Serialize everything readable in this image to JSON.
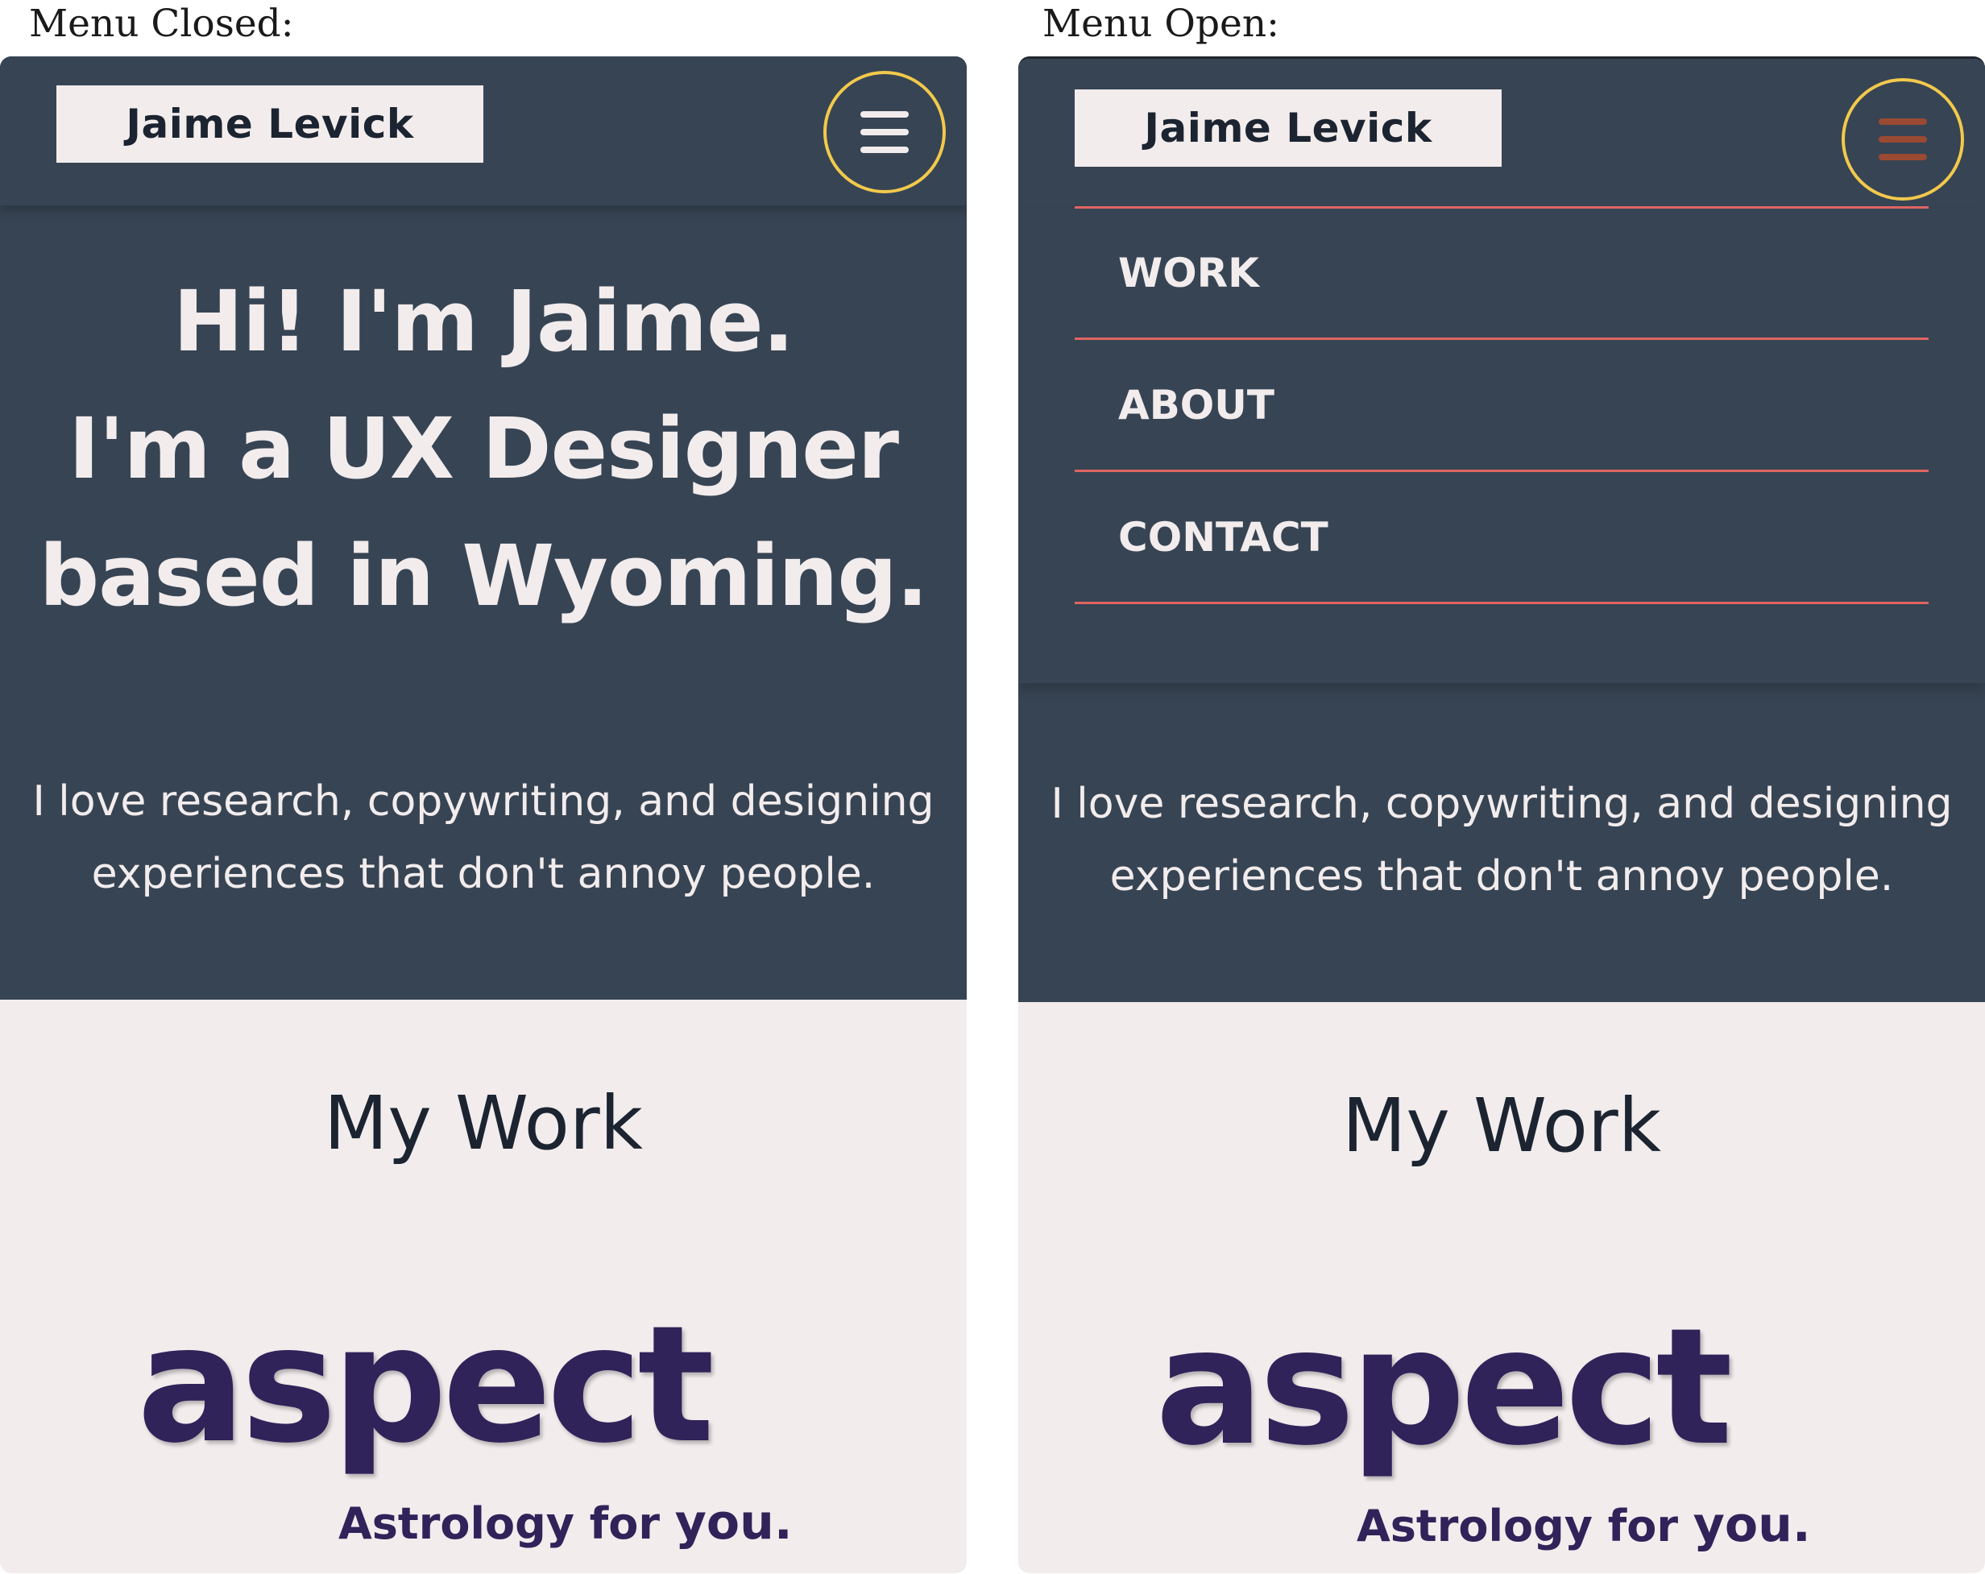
{
  "captions": {
    "closed": "Menu Closed:",
    "open": "Menu Open:"
  },
  "site": {
    "logo_text": "Jaime Levick",
    "headline": [
      "Hi! I'm Jaime.",
      "I'm a UX Designer",
      "based in Wyoming."
    ],
    "intro": "I love research, copywriting, and designing experiences that don't annoy people.",
    "work_title": "My Work",
    "project": {
      "logo_word": "aspect",
      "tagline_prefix": "Astrology for ",
      "tagline_emphasis": "you."
    }
  },
  "menu": {
    "items": [
      {
        "label": "WORK"
      },
      {
        "label": "ABOUT"
      },
      {
        "label": "CONTACT"
      }
    ]
  },
  "colors": {
    "hero_bg": "#374453",
    "page_bg": "#f2eced",
    "highlight_ring": "#f2c94c",
    "menu_divider": "#e06461",
    "brand_purple": "#2f2359"
  },
  "icons": {
    "menu": "hamburger-icon"
  }
}
